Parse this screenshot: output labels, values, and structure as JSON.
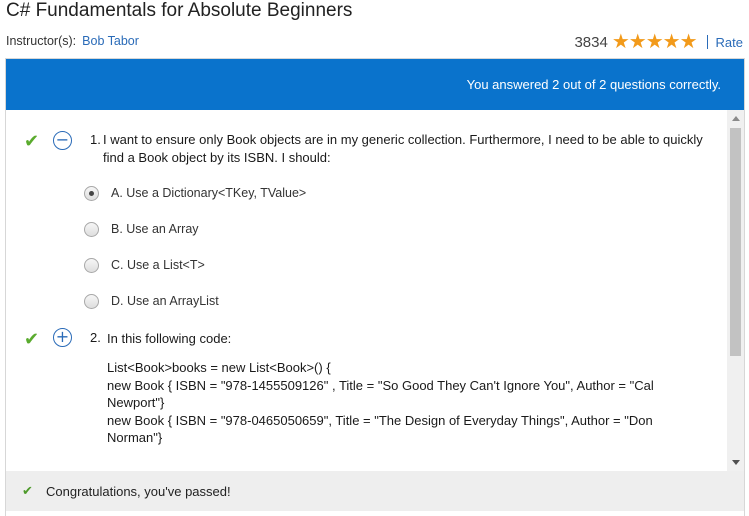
{
  "course": {
    "title": "C# Fundamentals for Absolute Beginners",
    "instructor_label": "Instructor(s):",
    "instructor_name": "Bob Tabor",
    "rating_count": "3834",
    "rating_stars": 5,
    "rate_label": "Rate"
  },
  "quiz": {
    "result_banner": "You answered 2 out of 2 questions correctly.",
    "questions": [
      {
        "number": "1.",
        "text": "I want to ensure only Book objects are in my generic collection. Furthermore, I need to be able to quickly find a Book object by its ISBN. I should:",
        "correct": true,
        "expanded": true,
        "toggle_icon": "collapse-minus-icon",
        "options": [
          {
            "label": "A. Use a Dictionary<TKey, TValue>",
            "selected": true
          },
          {
            "label": "B. Use an Array",
            "selected": false
          },
          {
            "label": "C. Use a List<T>",
            "selected": false
          },
          {
            "label": "D. Use an ArrayList",
            "selected": false
          }
        ]
      },
      {
        "number": "2.",
        "text": "In this following code:",
        "correct": true,
        "expanded": false,
        "toggle_icon": "expand-plus-icon",
        "code_lines": [
          "List<Book>books = new List<Book>() {",
          "new Book { ISBN = \"978-1455509126\" , Title = \"So Good They Can't Ignore You\", Author = \"Cal Newport\"}",
          "new Book { ISBN = \"978-0465050659\", Title = \"The Design of Everyday Things\", Author = \"Don Norman\"}"
        ]
      }
    ],
    "footer_message": "Congratulations, you've passed!"
  },
  "icons": {
    "star": "star-icon",
    "correct": "checkmark-icon"
  },
  "colors": {
    "accent_blue": "#0a73cc",
    "link_blue": "#2a6bb8",
    "star_orange": "#f29a1a",
    "check_green": "#5aab2e"
  }
}
